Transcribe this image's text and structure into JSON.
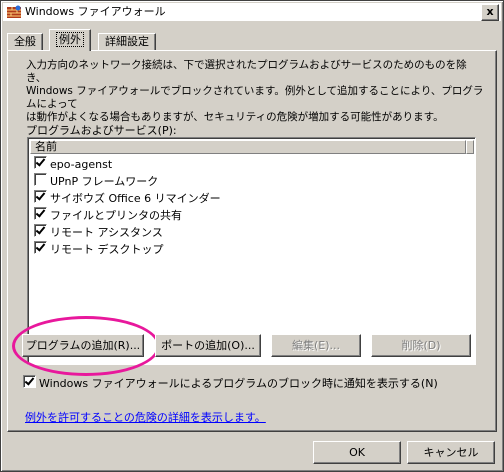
{
  "window": {
    "title": "Windows ファイアウォール",
    "close_glyph": "x"
  },
  "tabs": [
    {
      "label": "全般"
    },
    {
      "label": "例外"
    },
    {
      "label": "詳細設定"
    }
  ],
  "description": "入力方向のネットワーク接続は、下で選択されたプログラムおよびサービスのためのものを除き、\nWindows ファイアウォールでブロックされています。例外として追加することにより、プログラムによって\nは動作がよくなる場合もありますが、セキュリティの危険が増加する可能性があります。",
  "programs": {
    "label": "プログラムおよびサービス(P):",
    "column_header": "名前",
    "items": [
      {
        "label": "epo-agenst",
        "checked": true
      },
      {
        "label": "UPnP フレームワーク",
        "checked": false
      },
      {
        "label": "サイボウズ Office 6 リマインダー",
        "checked": true
      },
      {
        "label": "ファイルとプリンタの共有",
        "checked": true
      },
      {
        "label": "リモート アシスタンス",
        "checked": true
      },
      {
        "label": "リモート デスクトップ",
        "checked": true
      }
    ]
  },
  "buttons": {
    "add_program": "プログラムの追加(R)...",
    "add_port": "ポートの追加(O)...",
    "edit": "編集(E)...",
    "delete": "削除(D)",
    "ok": "OK",
    "cancel": "キャンセル"
  },
  "notify": {
    "label": "Windows ファイアウォールによるプログラムのブロック時に通知を表示する(N)",
    "checked": true
  },
  "link_text": "例外を許可することの危険の詳細を表示します。",
  "colors": {
    "dialog_bg": "#d4d0c8",
    "highlight_ellipse": "#e8189c",
    "link": "#0000ff"
  }
}
